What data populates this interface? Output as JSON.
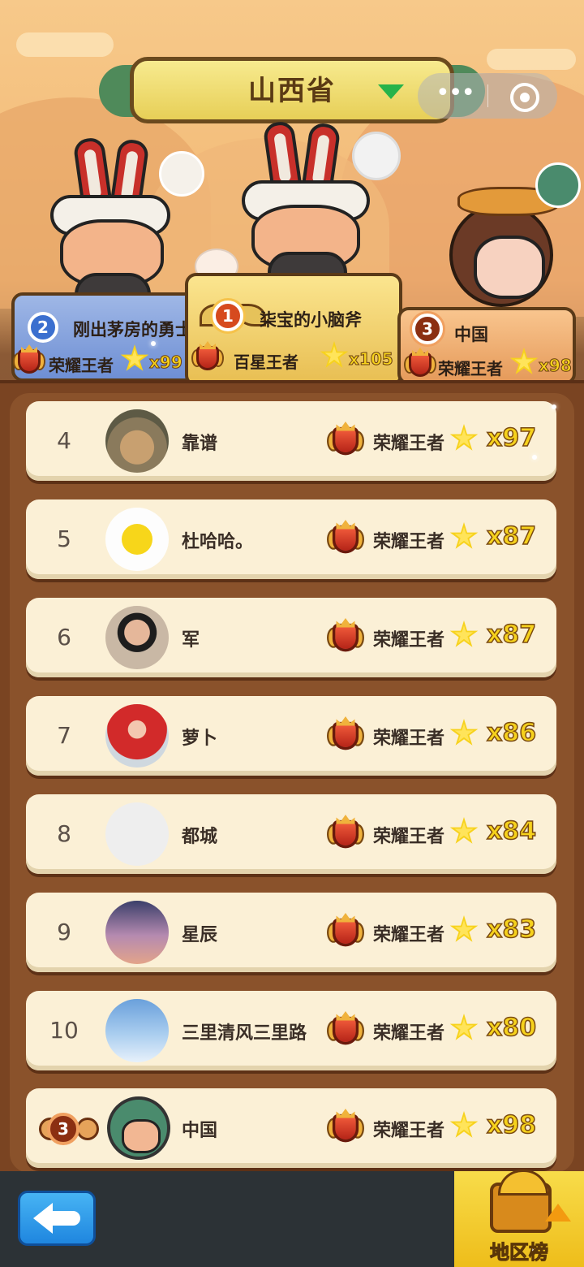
{
  "header": {
    "province": "山西省",
    "capsule_more": "•••"
  },
  "podium": [
    {
      "rank": "2",
      "name": "刚出茅房的勇士",
      "title": "荣耀王者",
      "stars": "x99"
    },
    {
      "rank": "1",
      "name": "柒宝的小脑斧",
      "title": "百星王者",
      "stars": "x105"
    },
    {
      "rank": "3",
      "name": "中国",
      "title": "荣耀王者",
      "stars": "x98"
    }
  ],
  "list": [
    {
      "rank": "4",
      "name": "靠谱",
      "title": "荣耀王者",
      "stars": "x97"
    },
    {
      "rank": "5",
      "name": "杜哈哈。",
      "title": "荣耀王者",
      "stars": "x87"
    },
    {
      "rank": "6",
      "name": "军",
      "title": "荣耀王者",
      "stars": "x87"
    },
    {
      "rank": "7",
      "name": "萝卜",
      "title": "荣耀王者",
      "stars": "x86"
    },
    {
      "rank": "8",
      "name": "都城",
      "title": "荣耀王者",
      "stars": "x84"
    },
    {
      "rank": "9",
      "name": "星辰",
      "title": "荣耀王者",
      "stars": "x83"
    },
    {
      "rank": "10",
      "name": "三里清风三里路",
      "title": "荣耀王者",
      "stars": "x80"
    }
  ],
  "self": {
    "rank": "3",
    "name": "中国",
    "title": "荣耀王者",
    "stars": "x98"
  },
  "bottom": {
    "region_label": "地区榜"
  },
  "colors": {
    "accent_green": "#27b34a",
    "star_yellow": "#f6d21c",
    "panel_brown": "#7a4422"
  }
}
